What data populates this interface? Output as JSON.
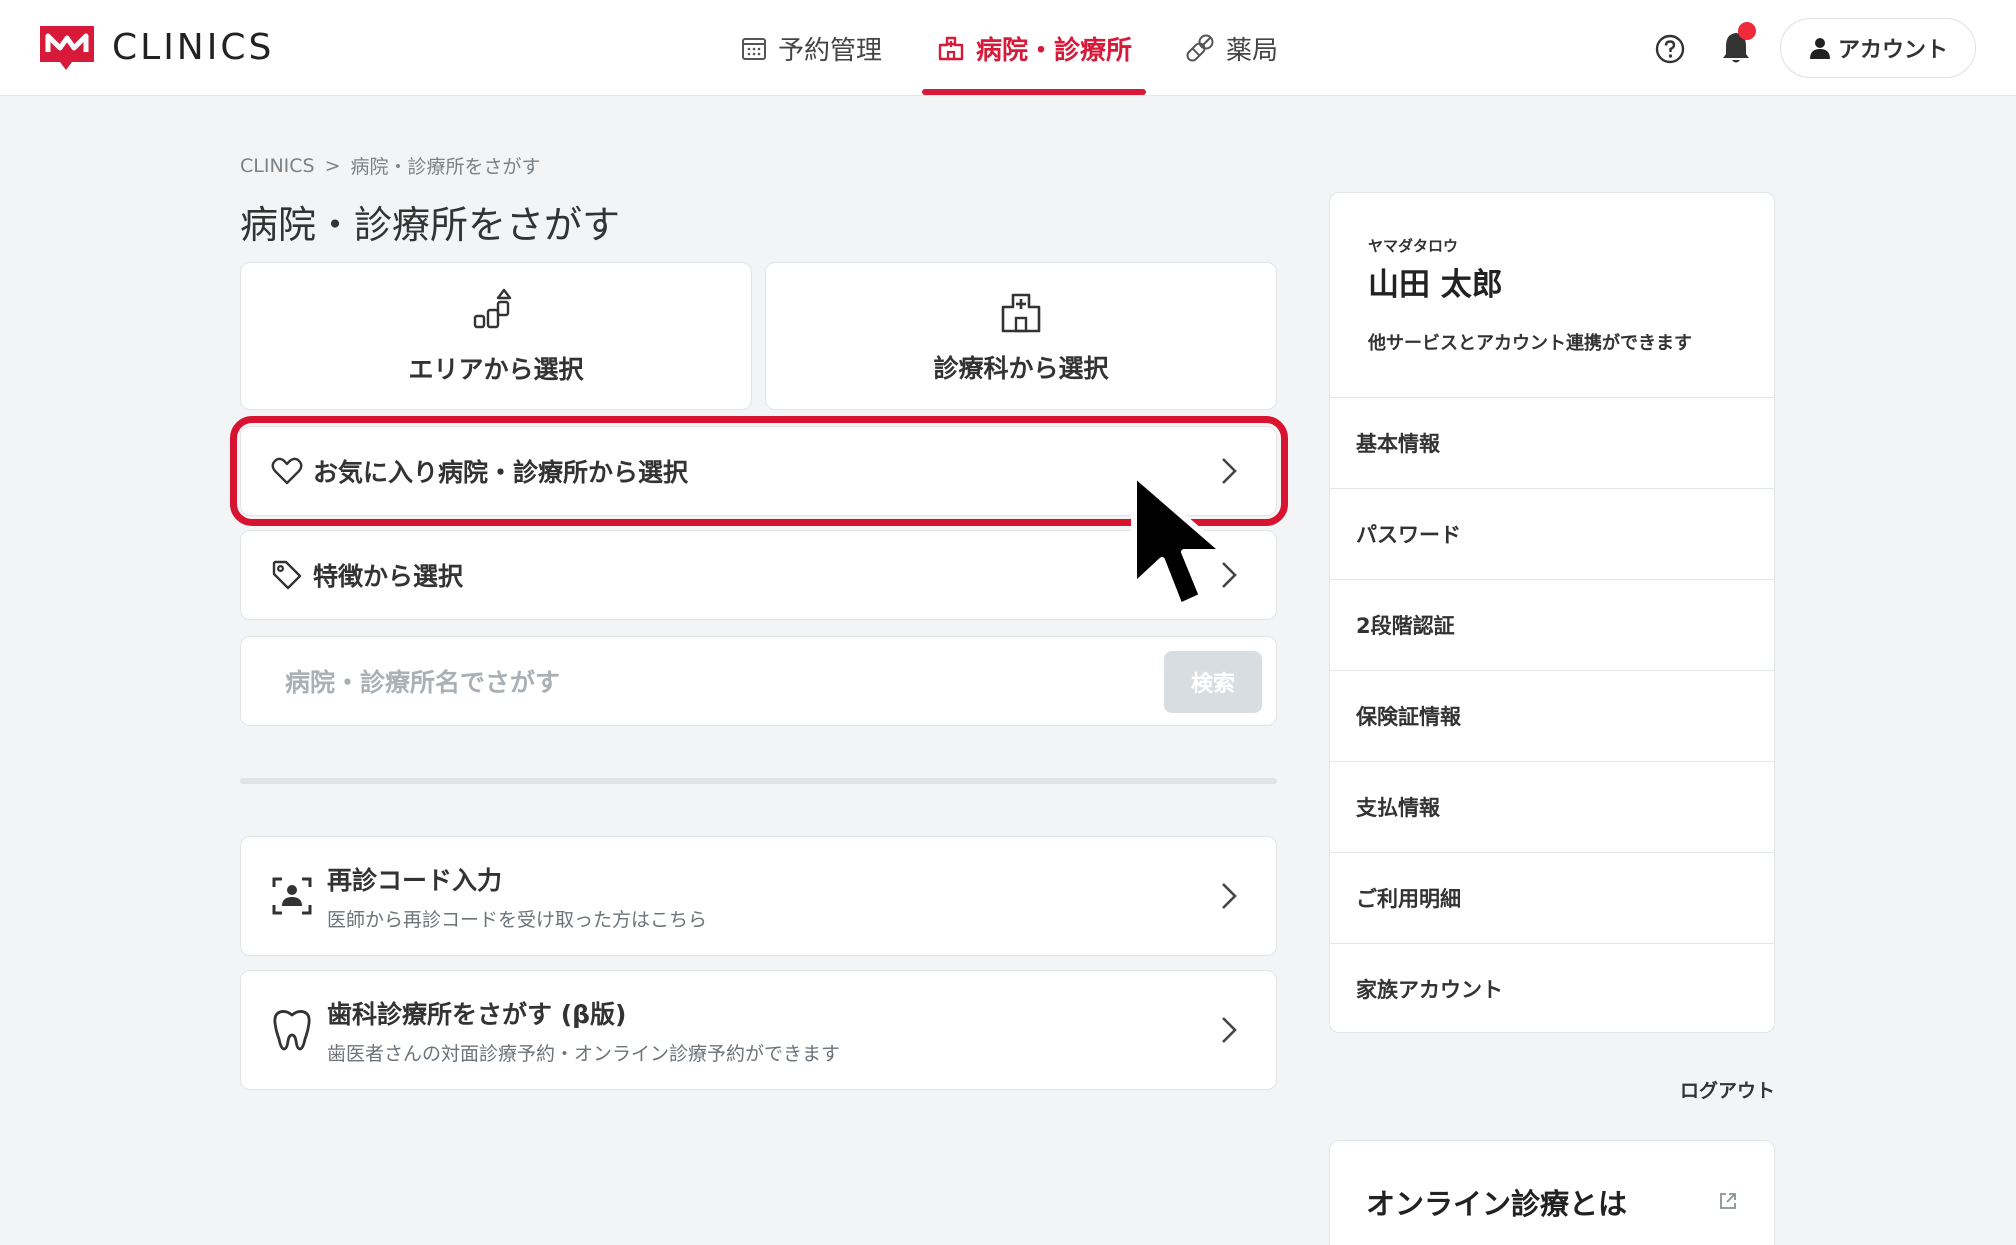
{
  "header": {
    "logo_text": "CLINICS",
    "nav": [
      {
        "label": "予約管理",
        "icon": "calendar-icon"
      },
      {
        "label": "病院・診療所",
        "icon": "hospital-icon",
        "active": true
      },
      {
        "label": "薬局",
        "icon": "pills-icon"
      }
    ],
    "account_label": "アカウント",
    "has_notification": true
  },
  "breadcrumb": {
    "root": "CLINICS",
    "separator": ">",
    "current": "病院・診療所をさがす"
  },
  "page_title": "病院・診療所をさがす",
  "tiles": {
    "area": "エリアから選択",
    "department": "診療科から選択"
  },
  "rows": {
    "favorites": "お気に入り病院・診療所から選択",
    "features": "特徴から選択"
  },
  "search": {
    "placeholder": "病院・診療所名でさがす",
    "button": "検索"
  },
  "revisit": {
    "title": "再診コード入力",
    "subtitle": "医師から再診コードを受け取った方はこちら"
  },
  "dental": {
    "title": "歯科診療所をさがす (β版)",
    "subtitle": "歯医者さんの対面診療予約・オンライン診療予約ができます"
  },
  "sidebar": {
    "kana": "ヤマダタロウ",
    "name": "山田 太郎",
    "description": "他サービスとアカウント連携ができます",
    "items": [
      "基本情報",
      "パスワード",
      "2段階認証",
      "保険証情報",
      "支払情報",
      "ご利用明細",
      "家族アカウント"
    ],
    "logout": "ログアウト"
  },
  "online": {
    "title": "オンライン診療とは"
  },
  "colors": {
    "accent": "#d7193a",
    "highlight": "#d7132f",
    "background": "#f3f4f5"
  }
}
